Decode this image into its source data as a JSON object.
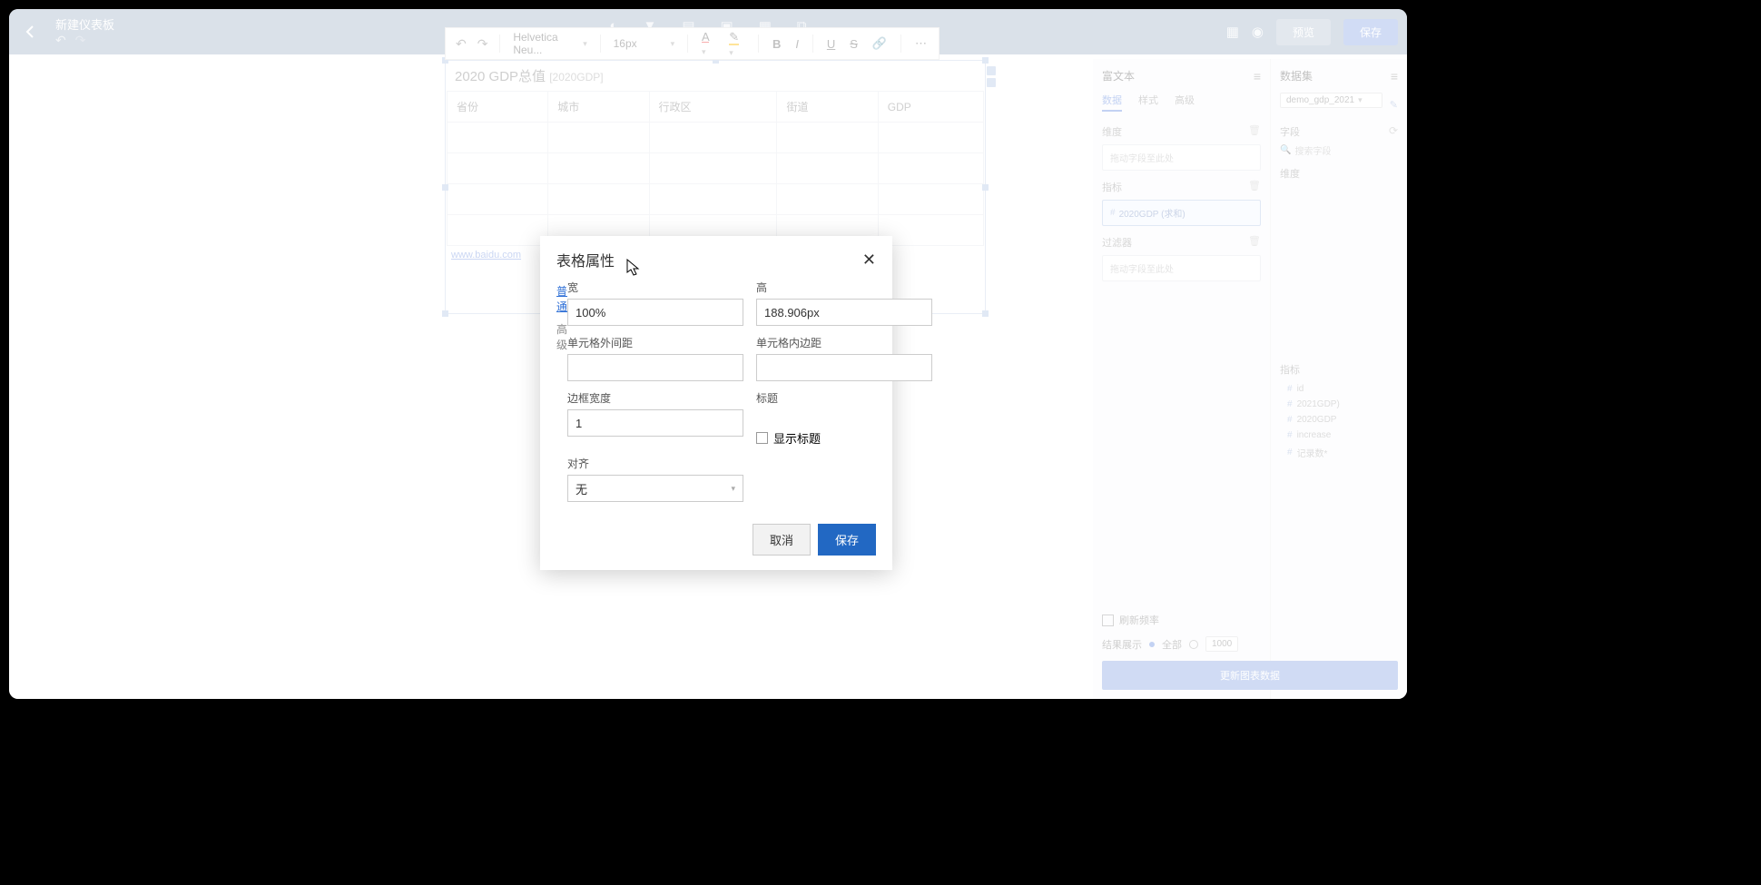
{
  "header": {
    "title": "新建仪表板",
    "preview_btn": "预览",
    "save_btn": "保存"
  },
  "toolbar": {
    "font_family": "Helvetica Neu...",
    "font_size": "16px"
  },
  "card": {
    "title_main": "2020 GDP总值",
    "title_code": "[2020GDP]",
    "columns": [
      "省份",
      "城市",
      "行政区",
      "街道",
      "GDP"
    ],
    "link": "www.baidu.com"
  },
  "right_panel": {
    "left_title": "富文本",
    "right_title": "数据集",
    "tabs": {
      "data": "数据",
      "style": "样式",
      "advanced": "高级"
    },
    "dimension_label": "维度",
    "drop_placeholder": "拖动字段至此处",
    "metric_label": "指标",
    "metric_value": "2020GDP (求和)",
    "filter_label": "过滤器",
    "dataset_selected": "demo_gdp_2021",
    "fields_label": "字段",
    "search_placeholder": "搜索字段",
    "dim_label": "维度",
    "metric_section": "指标",
    "fields": [
      "id",
      "2021GDP)",
      "2020GDP",
      "increase",
      "记录数*"
    ],
    "refresh_checkbox": "刷新频率",
    "result_label": "结果展示",
    "radio_all": "全部",
    "radio_num": "1000",
    "update_btn": "更新图表数据"
  },
  "modal": {
    "title": "表格属性",
    "nav_general": "普通",
    "nav_advanced": "高级",
    "width_label": "宽",
    "width_value": "100%",
    "height_label": "高",
    "height_value": "188.906px",
    "cell_spacing_label": "单元格外间距",
    "cell_padding_label": "单元格内边距",
    "border_width_label": "边框宽度",
    "border_width_value": "1",
    "caption_label": "标题",
    "show_caption": "显示标题",
    "align_label": "对齐",
    "align_value": "无",
    "cancel": "取消",
    "save": "保存"
  }
}
